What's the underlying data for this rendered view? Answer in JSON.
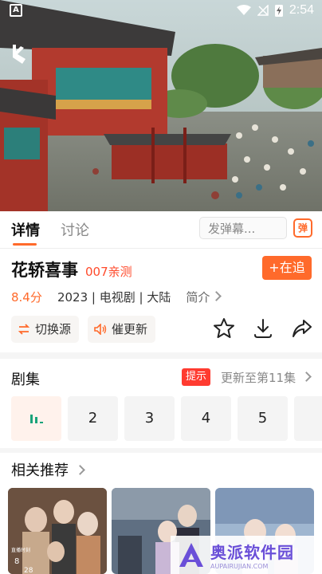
{
  "status_bar": {
    "time": "2:54",
    "left_icon": "A"
  },
  "video": {
    "back_icon": "back-icon"
  },
  "tabs": [
    {
      "label": "详情",
      "active": true
    },
    {
      "label": "讨论",
      "active": false
    }
  ],
  "danmaku": {
    "placeholder": "发弹幕...",
    "icon_label": "弹"
  },
  "show": {
    "title": "花轿喜事",
    "tag": "007亲测",
    "follow_label": "+在追",
    "rating": "8.4分",
    "info": "2023 | 电视剧 | 大陆",
    "intro_label": "简介"
  },
  "chips": [
    {
      "label": "切换源",
      "icon": "switch-icon"
    },
    {
      "label": "催更新",
      "icon": "speaker-icon"
    }
  ],
  "actions": [
    "star-icon",
    "download-icon",
    "share-icon"
  ],
  "episodes": {
    "title": "剧集",
    "hint": "提示",
    "update": "更新至第11集",
    "items": [
      "2",
      "3",
      "4",
      "5"
    ]
  },
  "recommend": {
    "title": "相关推荐"
  },
  "poster_texts": {
    "p1_a": "直播时刻",
    "p1_b": "8",
    "p1_c": "28"
  },
  "watermark": {
    "text": "奥派软件园",
    "sub": "AUPAIRUJIAN.COM"
  },
  "colors": {
    "accent": "#ff6a2b",
    "badge": "#ff3b30"
  }
}
